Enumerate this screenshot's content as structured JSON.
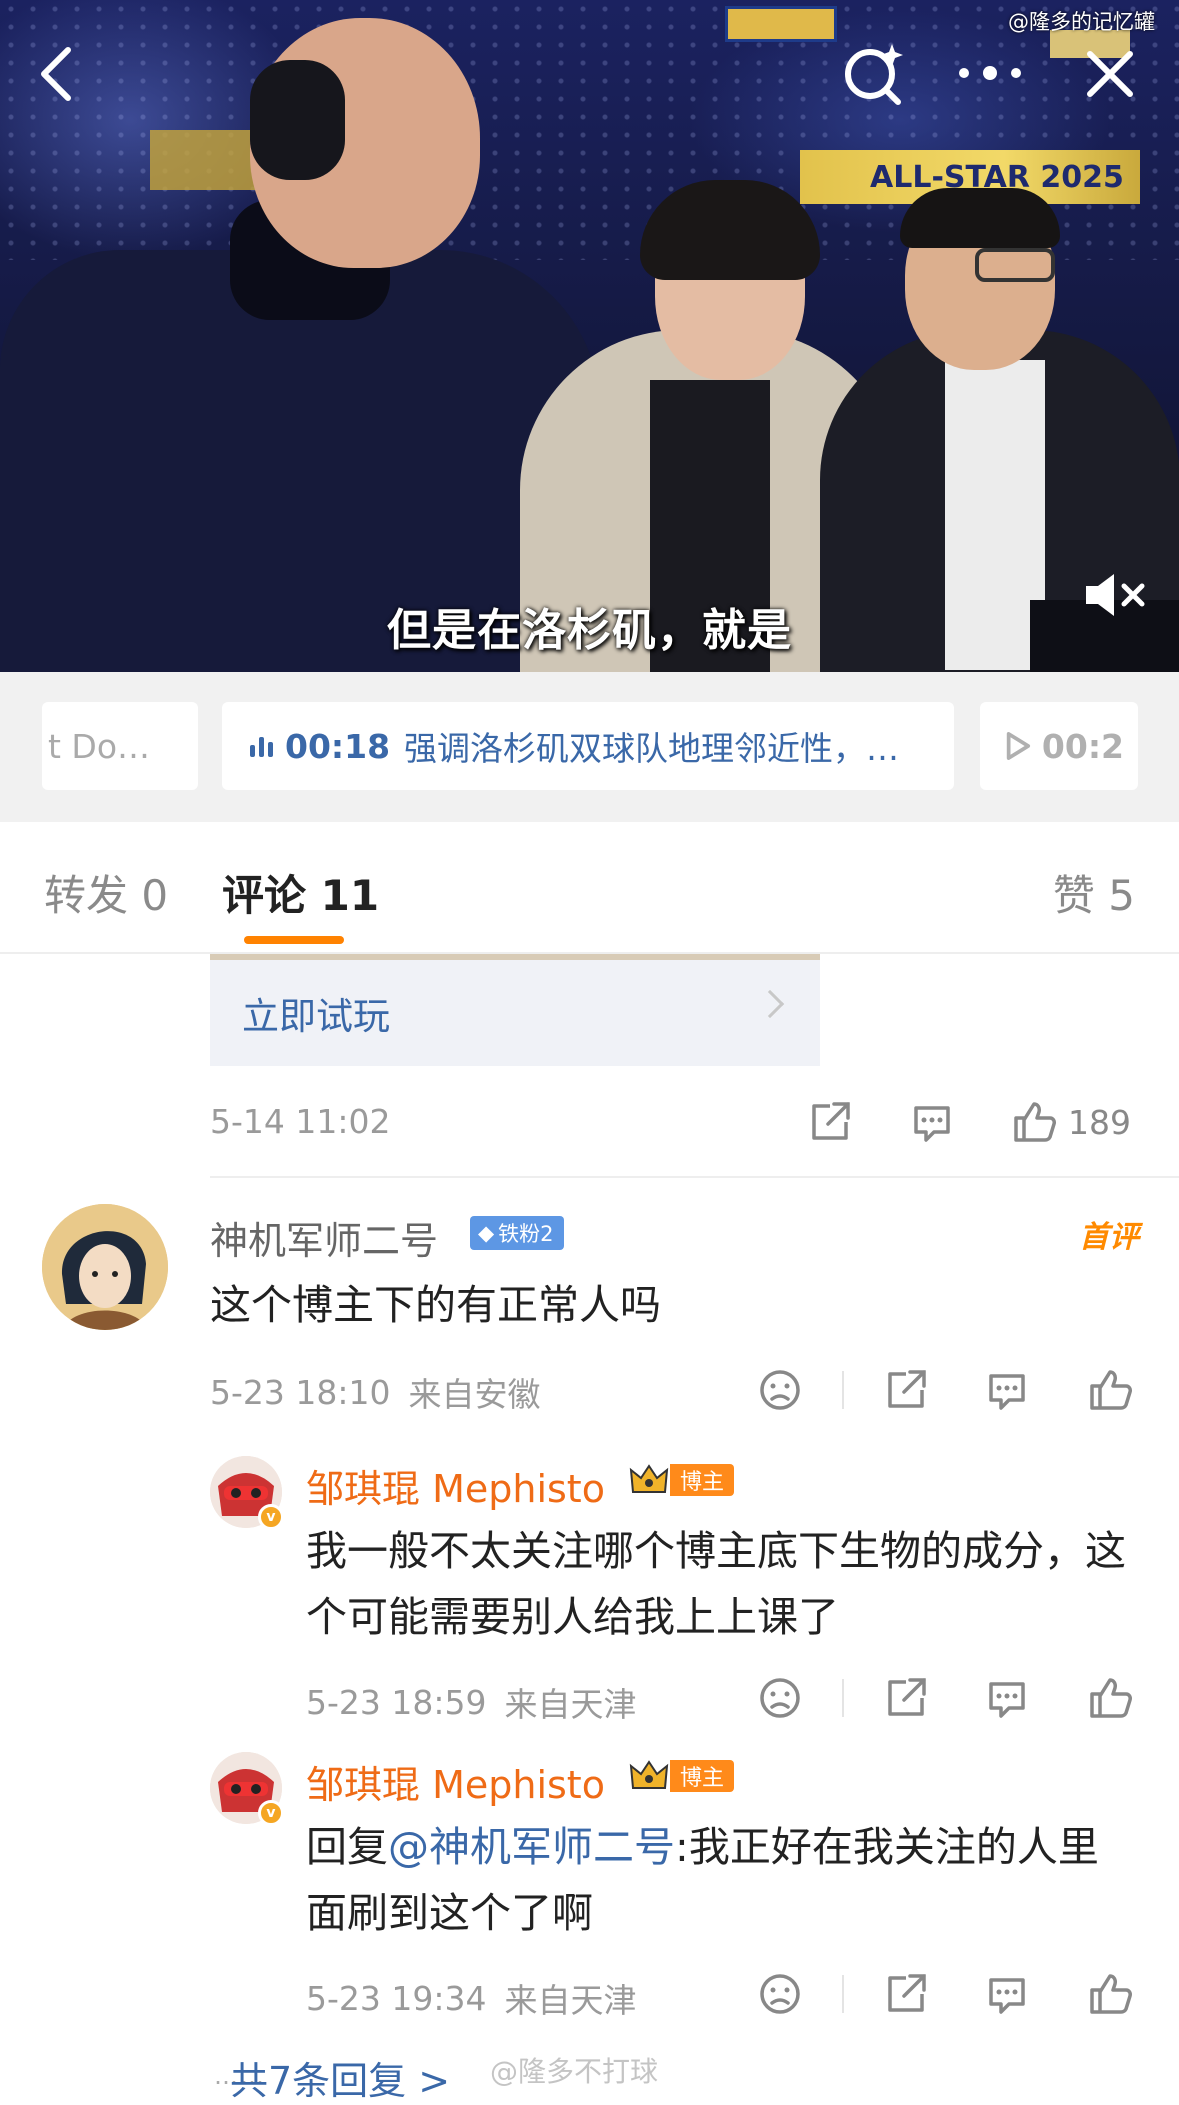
{
  "video": {
    "watermark": "@隆多的记忆罐",
    "subtitle": "但是在洛杉矶，就是",
    "arena_banner": "ALL-STAR 2025",
    "buttons": {
      "back": "back-icon",
      "search": "search-sparkle-icon",
      "more": "more-icon",
      "close": "close-icon",
      "mute": "mute-icon"
    }
  },
  "chapters": {
    "prev": {
      "text": "t Do…"
    },
    "current": {
      "time": "00:18",
      "text": "强调洛杉矶双球队地理邻近性，…"
    },
    "next": {
      "time": "00:2"
    }
  },
  "tabs": {
    "repost": "转发 0",
    "comments": "评论 11",
    "likes": "赞 5",
    "active_color": "#ff8200"
  },
  "prev_post": {
    "ad_cta": "立即试玩",
    "time": "5-14 11:02",
    "likes": "189"
  },
  "comments": [
    {
      "username": "神机军师二号",
      "fan_badge": "铁粉2",
      "first_tag": "首评",
      "text": "这个博主下的有正常人吗",
      "time": "5-23 18:10",
      "location": "来自安徽",
      "replies": [
        {
          "username": "邹琪琨 Mephisto",
          "badge": "博主",
          "text": "我一般不太关注哪个博主底下生物的成分，这个可能需要别人给我上上课了",
          "time": "5-23 18:59",
          "location": "来自天津"
        },
        {
          "username": "邹琪琨 Mephisto",
          "badge": "博主",
          "reply_prefix": "回复",
          "mention": "@神机军师二号",
          "text": ":我正好在我关注的人里面刷到这个了啊",
          "time": "5-23 19:34",
          "location": "来自天津"
        }
      ],
      "more_replies": "共7条回复 >"
    }
  ],
  "bottom_watermark": "@隆多不打球",
  "colors": {
    "link_blue": "#3a68a8",
    "orange_name": "#ef6b16",
    "fan_badge": "#5d97e4",
    "blogger_badge": "#ff8a1a"
  }
}
